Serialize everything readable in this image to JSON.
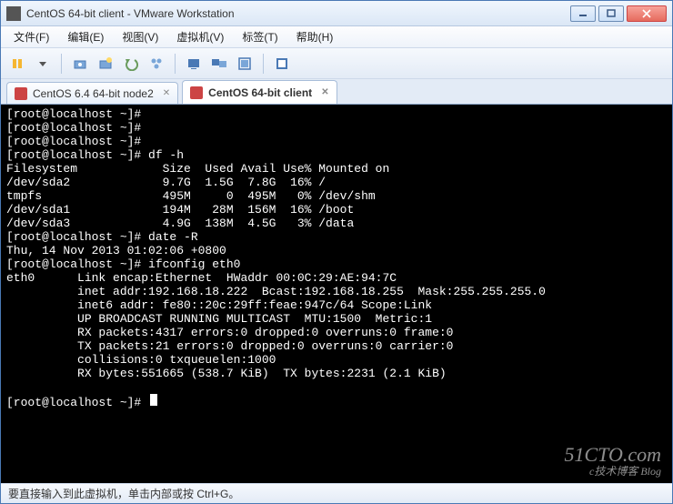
{
  "window": {
    "title": "CentOS 64-bit client - VMware Workstation"
  },
  "menu": {
    "file": "文件(F)",
    "edit": "编辑(E)",
    "view": "视图(V)",
    "vm": "虚拟机(V)",
    "tabs": "标签(T)",
    "help": "帮助(H)"
  },
  "tabs": {
    "t1": "CentOS 6.4 64-bit node2",
    "t2": "CentOS 64-bit client"
  },
  "terminal": {
    "lines": [
      "[root@localhost ~]#",
      "[root@localhost ~]#",
      "[root@localhost ~]#",
      "[root@localhost ~]# df -h",
      "Filesystem            Size  Used Avail Use% Mounted on",
      "/dev/sda2             9.7G  1.5G  7.8G  16% /",
      "tmpfs                 495M     0  495M   0% /dev/shm",
      "/dev/sda1             194M   28M  156M  16% /boot",
      "/dev/sda3             4.9G  138M  4.5G   3% /data",
      "[root@localhost ~]# date -R",
      "Thu, 14 Nov 2013 01:02:06 +0800",
      "[root@localhost ~]# ifconfig eth0",
      "eth0      Link encap:Ethernet  HWaddr 00:0C:29:AE:94:7C",
      "          inet addr:192.168.18.222  Bcast:192.168.18.255  Mask:255.255.255.0",
      "          inet6 addr: fe80::20c:29ff:feae:947c/64 Scope:Link",
      "          UP BROADCAST RUNNING MULTICAST  MTU:1500  Metric:1",
      "          RX packets:4317 errors:0 dropped:0 overruns:0 frame:0",
      "          TX packets:21 errors:0 dropped:0 overruns:0 carrier:0",
      "          collisions:0 txqueuelen:1000",
      "          RX bytes:551665 (538.7 KiB)  TX bytes:2231 (2.1 KiB)",
      "",
      "[root@localhost ~]# "
    ]
  },
  "status": {
    "text": "要直接输入到此虚拟机，单击内部或按 Ctrl+G。"
  },
  "watermark": {
    "main": "51CTO.com",
    "sub": "c技术博客  Blog"
  }
}
